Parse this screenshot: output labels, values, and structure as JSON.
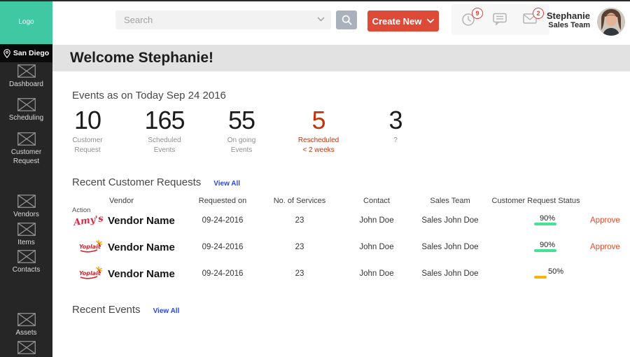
{
  "app": {
    "logo": "Logo",
    "location": "San Diego"
  },
  "sidebar": {
    "items": [
      {
        "label": "Dashboard"
      },
      {
        "label": "Scheduling"
      },
      {
        "label": "Customer Request"
      },
      {
        "label": "Vendors"
      },
      {
        "label": "Items"
      },
      {
        "label": "Contacts"
      },
      {
        "label": "Assets"
      },
      {
        "label": ""
      }
    ]
  },
  "topbar": {
    "search_placeholder": "Search",
    "create_new": "Create New",
    "notifications": [
      {
        "icon": "clock",
        "badge": "9"
      },
      {
        "icon": "chat",
        "badge": ""
      },
      {
        "icon": "envelope",
        "badge": "2"
      }
    ],
    "user": {
      "name": "Stephanie",
      "team": "Sales Team"
    }
  },
  "welcome": {
    "title": "Welcome Stephanie!"
  },
  "events_summary": {
    "title": "Events as on Today Sep 24 2016",
    "stats": [
      {
        "value": "10",
        "label1": "Customer",
        "label2": "Request",
        "highlight": false
      },
      {
        "value": "165",
        "label1": "Scheduled",
        "label2": "Events",
        "highlight": false
      },
      {
        "value": "55",
        "label1": "On going",
        "label2": "Events",
        "highlight": false
      },
      {
        "value": "5",
        "label1": "Rescheduled",
        "label2": "< 2 weeks",
        "highlight": true
      },
      {
        "value": "3",
        "label1": "?",
        "label2": "",
        "highlight": false
      }
    ]
  },
  "requests": {
    "title": "Recent Customer Requests",
    "view_all": "View All",
    "action_label": "Action",
    "columns": [
      "Vendor",
      "Requested on",
      "No. of Services",
      "Contact",
      "Sales Team",
      "Customer Request Status"
    ],
    "rows": [
      {
        "logo": "amys",
        "logo_text": "Amy's",
        "vendor": "Vendor Name",
        "requested_on": "09-24-2016",
        "services": "23",
        "contact": "John Doe",
        "sales_team": "Sales John Doe",
        "status_pct": 90,
        "status_color": "#42e396",
        "approve": "Approve"
      },
      {
        "logo": "yoplait",
        "logo_text": "Yoplait",
        "vendor": "Vendor Name",
        "requested_on": "09-24-2016",
        "services": "23",
        "contact": "John Doe",
        "sales_team": "Sales John Doe",
        "status_pct": 90,
        "status_color": "#42e396",
        "approve": "Approve"
      },
      {
        "logo": "yoplait",
        "logo_text": "Yoplait",
        "vendor": "Vendor Name",
        "requested_on": "09-24-2016",
        "services": "23",
        "contact": "John Doe",
        "sales_team": "Sales John Doe",
        "status_pct": 50,
        "status_color": "#f6b609",
        "approve": ""
      }
    ]
  },
  "recent_events": {
    "title": "Recent Events",
    "view_all": "View All"
  },
  "colors": {
    "accent_teal": "#3fc8a1",
    "primary_red": "#dd4a38",
    "stat_red": "#c5330c",
    "link_blue": "#2b49d8",
    "status_green": "#42e396",
    "status_yellow": "#f6b609"
  }
}
